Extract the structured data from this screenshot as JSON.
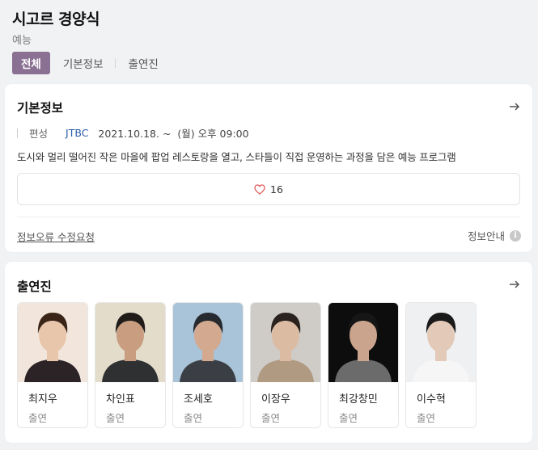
{
  "header": {
    "title": "시고르 경양식",
    "genre": "예능",
    "tabs": [
      {
        "label": "전체",
        "active": true
      },
      {
        "label": "기본정보",
        "active": false
      },
      {
        "label": "출연진",
        "active": false
      }
    ]
  },
  "basic_info": {
    "section_title": "기본정보",
    "meta_label": "편성",
    "channel": "JTBC",
    "schedule": "2021.10.18. ~  (월) 오후 09:00",
    "description": "도시와 멀리 떨어진 작은 마을에 팝업 레스토랑을 열고, 스타들이 직접 운영하는 과정을 담은 예능 프로그램",
    "like_count": "16",
    "report_link": "정보오류 수정요청",
    "info_guide": "정보안내",
    "info_icon_glyph": "i"
  },
  "cast": {
    "section_title": "출연진",
    "members": [
      {
        "name": "최지우",
        "role": "출연",
        "photo_colors": [
          "#f2e6dc",
          "#3a2418",
          "#e8c6ab",
          "#2b2326"
        ]
      },
      {
        "name": "차인표",
        "role": "출연",
        "photo_colors": [
          "#e3dccb",
          "#1f1c1a",
          "#c99d80",
          "#2e3032"
        ]
      },
      {
        "name": "조세호",
        "role": "출연",
        "photo_colors": [
          "#a9c3d8",
          "#26292e",
          "#d3a98f",
          "#3b3f45"
        ]
      },
      {
        "name": "이장우",
        "role": "출연",
        "photo_colors": [
          "#cfcbc6",
          "#2a221d",
          "#dcbba3",
          "#b19a82"
        ]
      },
      {
        "name": "최강창민",
        "role": "출연",
        "photo_colors": [
          "#0d0d0d",
          "#161616",
          "#caa48c",
          "#6b6b6b"
        ]
      },
      {
        "name": "이수혁",
        "role": "출연",
        "photo_colors": [
          "#eef0f2",
          "#1a1a1a",
          "#e2c9b8",
          "#f6f6f6"
        ]
      }
    ]
  },
  "colors": {
    "accent": "#8a7193",
    "channel_link": "#2b5cab",
    "heart": "#e05b5b"
  }
}
